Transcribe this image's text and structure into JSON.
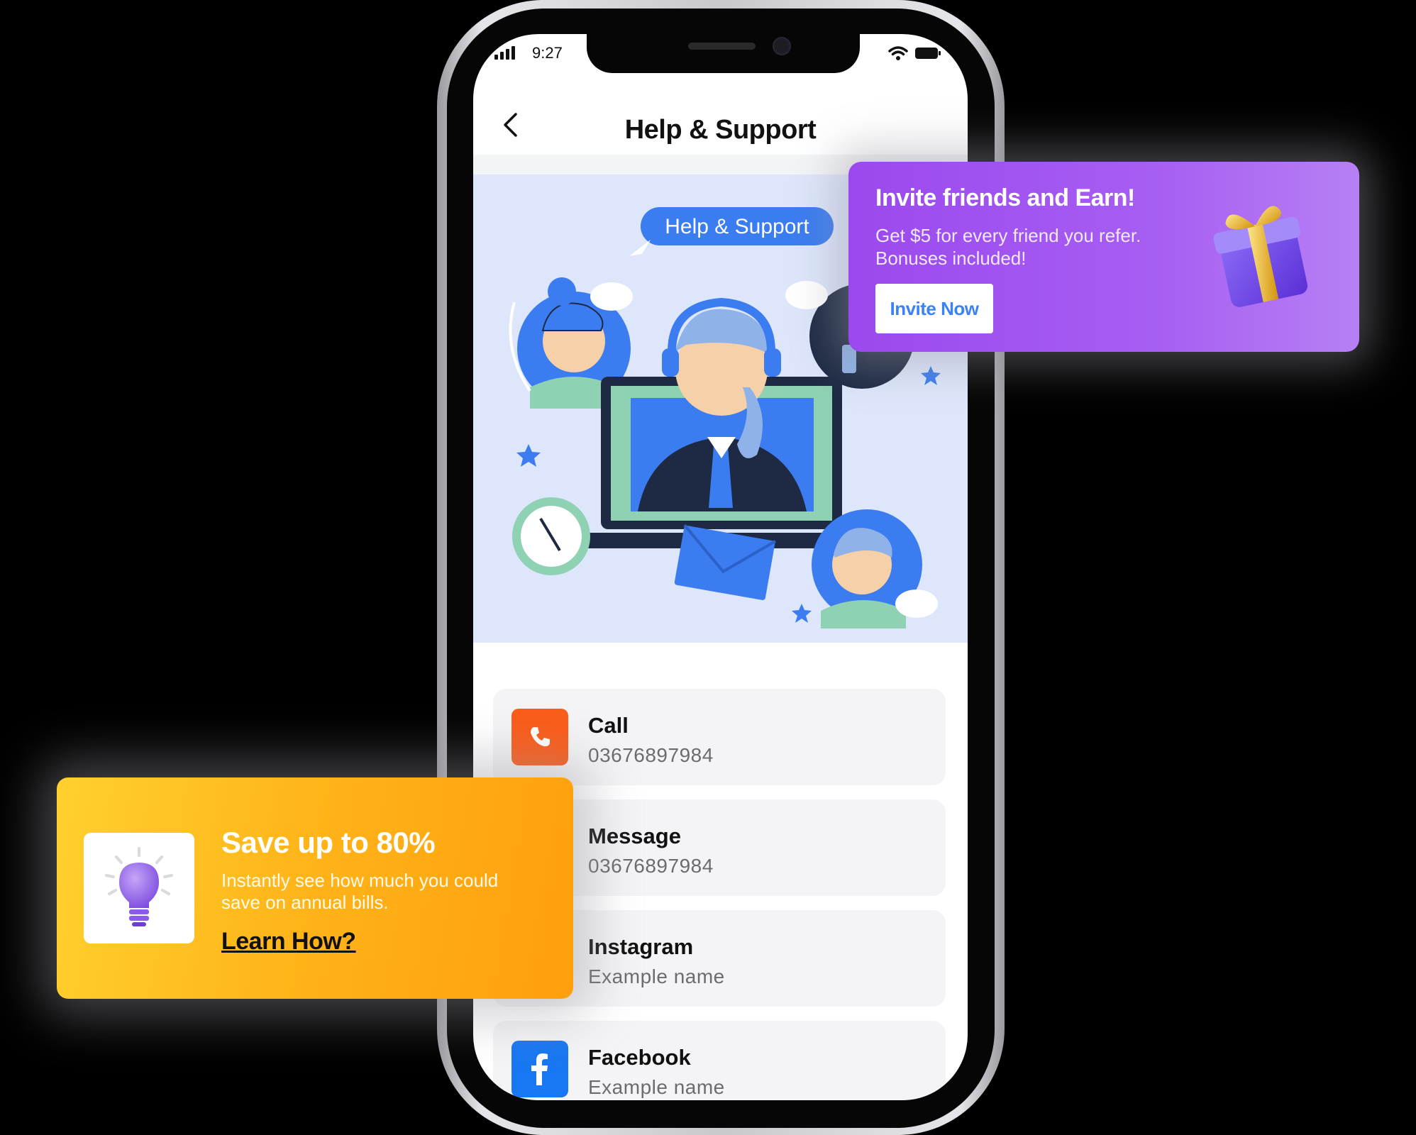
{
  "status_bar": {
    "time": "9:27"
  },
  "header": {
    "title": "Help & Support"
  },
  "illustration": {
    "bubble_label": "Help & Support"
  },
  "contacts": [
    {
      "title": "Call",
      "subtitle": "03676897984",
      "icon": "phone-icon",
      "color": "#fb5c1a"
    },
    {
      "title": "Message",
      "subtitle": "03676897984",
      "icon": "message-icon",
      "color": "#22c55e"
    },
    {
      "title": "Instagram",
      "subtitle": "Example name",
      "icon": "instagram-icon",
      "color": "#d6249f"
    },
    {
      "title": "Facebook",
      "subtitle": "Example name",
      "icon": "facebook-icon",
      "color": "#1877f2"
    }
  ],
  "invite_card": {
    "title": "Invite friends and Earn!",
    "description": "Get $5 for every friend you refer. Bonuses included!",
    "button_label": "Invite Now",
    "icon": "gift-icon",
    "background": "#a259f2"
  },
  "save_card": {
    "title": "Save up to 80%",
    "description": "Instantly see how much you could save on annual bills.",
    "link_label": "Learn How?",
    "icon": "lightbulb-icon",
    "background": "#ffb318"
  }
}
